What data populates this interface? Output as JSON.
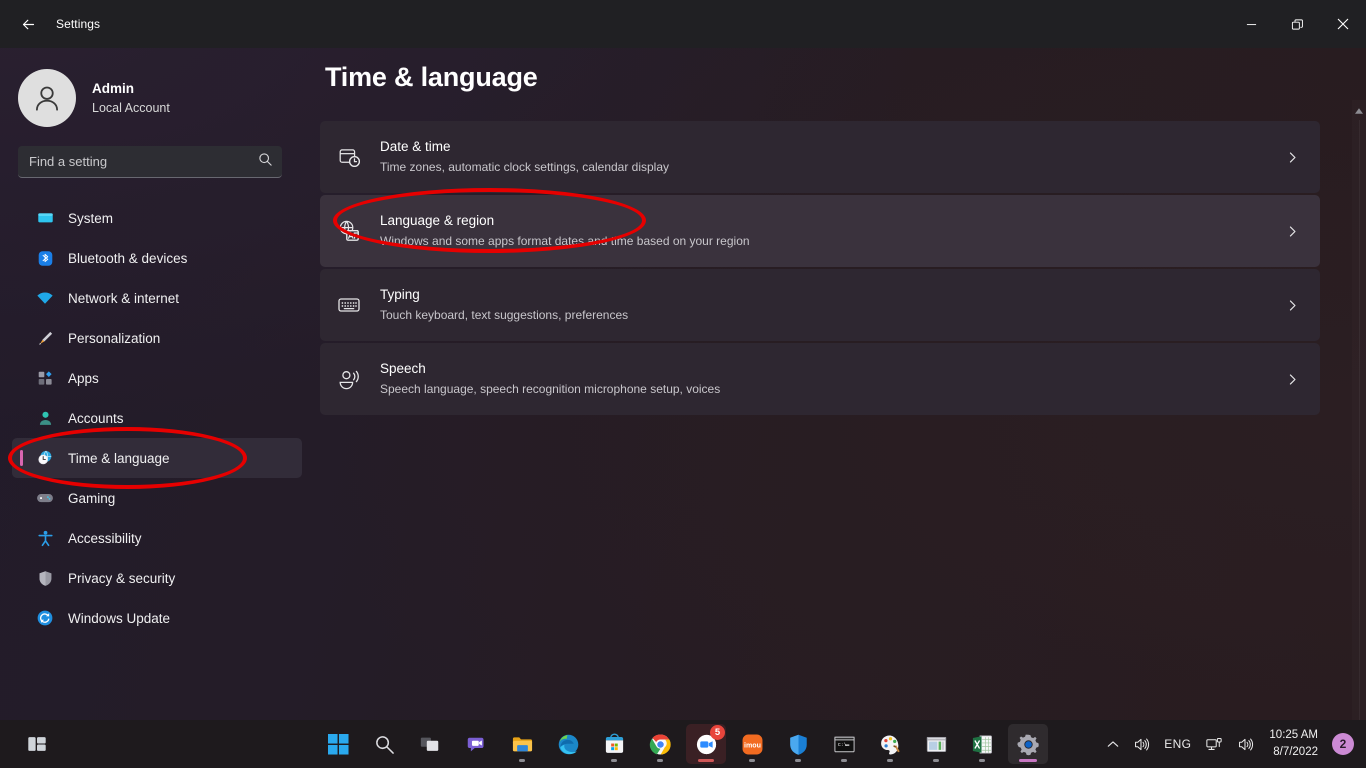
{
  "window": {
    "title": "Settings",
    "back_icon": "back-arrow-icon",
    "controls": {
      "minimize": "minimize-icon",
      "maximize": "restore-icon",
      "close": "close-icon"
    }
  },
  "account": {
    "name": "Admin",
    "subtitle": "Local Account",
    "avatar_icon": "person-avatar-icon"
  },
  "search": {
    "placeholder": "Find a setting",
    "value": "",
    "icon": "search-icon"
  },
  "sidebar": {
    "selected_index": 6,
    "accent_color": "#d966b0",
    "items": [
      {
        "label": "System",
        "icon": "monitor-icon"
      },
      {
        "label": "Bluetooth & devices",
        "icon": "bluetooth-icon"
      },
      {
        "label": "Network & internet",
        "icon": "wifi-icon"
      },
      {
        "label": "Personalization",
        "icon": "paintbrush-icon"
      },
      {
        "label": "Apps",
        "icon": "apps-grid-icon"
      },
      {
        "label": "Accounts",
        "icon": "person-icon"
      },
      {
        "label": "Time & language",
        "icon": "clock-globe-icon"
      },
      {
        "label": "Gaming",
        "icon": "gamepad-icon"
      },
      {
        "label": "Accessibility",
        "icon": "accessibility-person-icon"
      },
      {
        "label": "Privacy & security",
        "icon": "shield-icon"
      },
      {
        "label": "Windows Update",
        "icon": "update-refresh-icon"
      }
    ]
  },
  "main": {
    "page_title": "Time & language",
    "hovered_card_index": 1,
    "cards": [
      {
        "title": "Date & time",
        "subtitle": "Time zones, automatic clock settings, calendar display",
        "icon": "calendar-clock-icon",
        "chevron": "chevron-right-icon"
      },
      {
        "title": "Language & region",
        "subtitle": "Windows and some apps format dates and time based on your region",
        "icon": "globe-language-icon",
        "chevron": "chevron-right-icon"
      },
      {
        "title": "Typing",
        "subtitle": "Touch keyboard, text suggestions, preferences",
        "icon": "keyboard-icon",
        "chevron": "chevron-right-icon"
      },
      {
        "title": "Speech",
        "subtitle": "Speech language, speech recognition microphone setup, voices",
        "icon": "speech-person-icon",
        "chevron": "chevron-right-icon"
      }
    ]
  },
  "scrollbar": {
    "up_arrow_icon": "scroll-up-arrow-icon"
  },
  "taskbar": {
    "widgets_icon": "widgets-icon",
    "apps": [
      {
        "name": "start-button",
        "icon": "windows-logo-icon",
        "running": false,
        "active": false
      },
      {
        "name": "search-button",
        "icon": "search-icon",
        "running": false,
        "active": false
      },
      {
        "name": "task-view-button",
        "icon": "task-view-icon",
        "running": false,
        "active": false
      },
      {
        "name": "chat-button",
        "icon": "chat-video-icon",
        "running": false,
        "active": false
      },
      {
        "name": "file-explorer-button",
        "icon": "folder-icon",
        "running": true,
        "active": false
      },
      {
        "name": "edge-button",
        "icon": "edge-icon",
        "running": false,
        "active": false
      },
      {
        "name": "microsoft-store-button",
        "icon": "store-bag-icon",
        "running": true,
        "active": false
      },
      {
        "name": "chrome-button",
        "icon": "chrome-icon",
        "running": true,
        "active": false
      },
      {
        "name": "zoom-button",
        "icon": "zoom-icon",
        "running": true,
        "active": true,
        "badge": "5"
      },
      {
        "name": "imou-button",
        "icon": "imou-icon",
        "running": true,
        "active": false
      },
      {
        "name": "windows-security-button",
        "icon": "shield-icon",
        "running": true,
        "active": false
      },
      {
        "name": "command-prompt-button",
        "icon": "command-prompt-icon",
        "running": true,
        "active": false
      },
      {
        "name": "paint-button",
        "icon": "paint-palette-icon",
        "running": true,
        "active": false
      },
      {
        "name": "media-player-button",
        "icon": "window-app-icon",
        "running": true,
        "active": false
      },
      {
        "name": "excel-button",
        "icon": "excel-icon",
        "running": true,
        "active": false
      },
      {
        "name": "settings-button",
        "icon": "gear-icon",
        "running": true,
        "active": true
      }
    ],
    "tray": {
      "overflow_icon": "chevron-up-icon",
      "volume_icon": "speaker-icon",
      "language": "ENG",
      "network_icon": "network-monitor-icon",
      "sound_icon": "speaker-icon",
      "time": "10:25 AM",
      "date": "8/7/2022",
      "notification_count": "2",
      "notification_color": "#cc8ad4"
    }
  },
  "annotations": [
    {
      "name": "annotation-ellipse-sidebar",
      "target": "Time & language",
      "color": "#e60000"
    },
    {
      "name": "annotation-ellipse-card",
      "target": "Language & region",
      "color": "#e60000"
    }
  ]
}
